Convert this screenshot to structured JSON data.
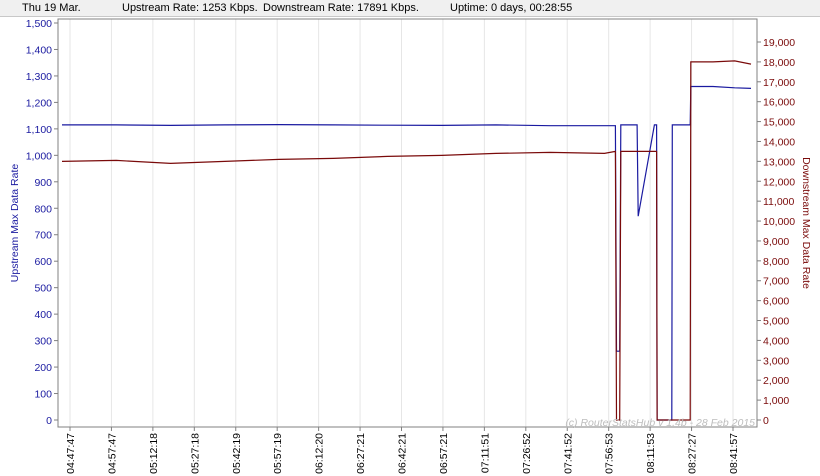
{
  "header": {
    "date": "Thu 19 Mar.",
    "upstream": "Upstream Rate: 1253 Kbps.",
    "downstream": "Downstream Rate: 17891 Kbps.",
    "uptime": "Uptime: 0 days, 00:28:55"
  },
  "watermark": "(c) RouterStatsHub v 1.4b - 28 Feb 2015",
  "chart_data": {
    "type": "line",
    "title": "",
    "xlabel": "",
    "x_ticks": [
      "04:47:47",
      "04:57:47",
      "05:12:18",
      "05:27:18",
      "05:42:19",
      "05:57:19",
      "06:12:20",
      "06:27:21",
      "06:42:21",
      "06:57:21",
      "07:11:51",
      "07:26:52",
      "07:41:52",
      "07:56:53",
      "08:11:53",
      "08:27:27",
      "08:41:57"
    ],
    "y_left": {
      "label": "Upstream Max Data Rate",
      "lim": [
        0,
        1500
      ],
      "ticks": [
        0,
        100,
        200,
        300,
        400,
        500,
        600,
        700,
        800,
        900,
        1000,
        1100,
        1200,
        1300,
        1400,
        1500
      ],
      "tick_labels": [
        "0",
        "100",
        "200",
        "300",
        "400",
        "500",
        "600",
        "700",
        "800",
        "900",
        "1,000",
        "1,100",
        "1,200",
        "1,300",
        "1,400",
        "1,500"
      ],
      "color": "#1a1aa0"
    },
    "y_right": {
      "label": "Downstream Max Data Rate",
      "lim": [
        0,
        19000
      ],
      "ticks": [
        0,
        1000,
        2000,
        3000,
        4000,
        5000,
        6000,
        7000,
        8000,
        9000,
        10000,
        11000,
        12000,
        13000,
        14000,
        15000,
        16000,
        17000,
        18000,
        19000
      ],
      "tick_labels": [
        "0",
        "1,000",
        "2,000",
        "3,000",
        "4,000",
        "5,000",
        "6,000",
        "7,000",
        "8,000",
        "9,000",
        "10,000",
        "11,000",
        "12,000",
        "13,000",
        "14,000",
        "15,000",
        "16,000",
        "17,000",
        "18,000",
        "19,000"
      ],
      "color": "#7a0a0a"
    },
    "grid": true,
    "series": [
      {
        "name": "Upstream Max Data Rate",
        "axis": "left",
        "color": "#1a1aa0",
        "x": [
          0,
          50,
          100,
          150,
          200,
          250,
          300,
          350,
          400,
          450,
          500,
          510,
          511,
          514,
          515,
          530,
          531,
          546,
          548,
          548.5,
          562,
          562.5,
          579,
          579.5,
          600,
          620,
          635
        ],
        "y": [
          1115,
          1115,
          1113,
          1115,
          1116,
          1115,
          1114,
          1113,
          1115,
          1112,
          1112,
          1112,
          260,
          260,
          1115,
          1115,
          770,
          1115,
          1115,
          0,
          0,
          1115,
          1115,
          1260,
          1260,
          1255,
          1253
        ]
      },
      {
        "name": "Downstream Max Data Rate",
        "axis": "right",
        "color": "#7a0a0a",
        "x": [
          0,
          50,
          100,
          150,
          200,
          250,
          300,
          350,
          400,
          450,
          500,
          510,
          511,
          514,
          515,
          530,
          531,
          546,
          548,
          548.5,
          562,
          562.5,
          579,
          579.5,
          600,
          620,
          635
        ],
        "y": [
          13000,
          13050,
          12900,
          13000,
          13100,
          13150,
          13250,
          13300,
          13400,
          13450,
          13400,
          13500,
          0,
          0,
          13500,
          13500,
          13500,
          13500,
          13500,
          0,
          0,
          0,
          0,
          18000,
          18000,
          18050,
          17891
        ]
      }
    ]
  }
}
